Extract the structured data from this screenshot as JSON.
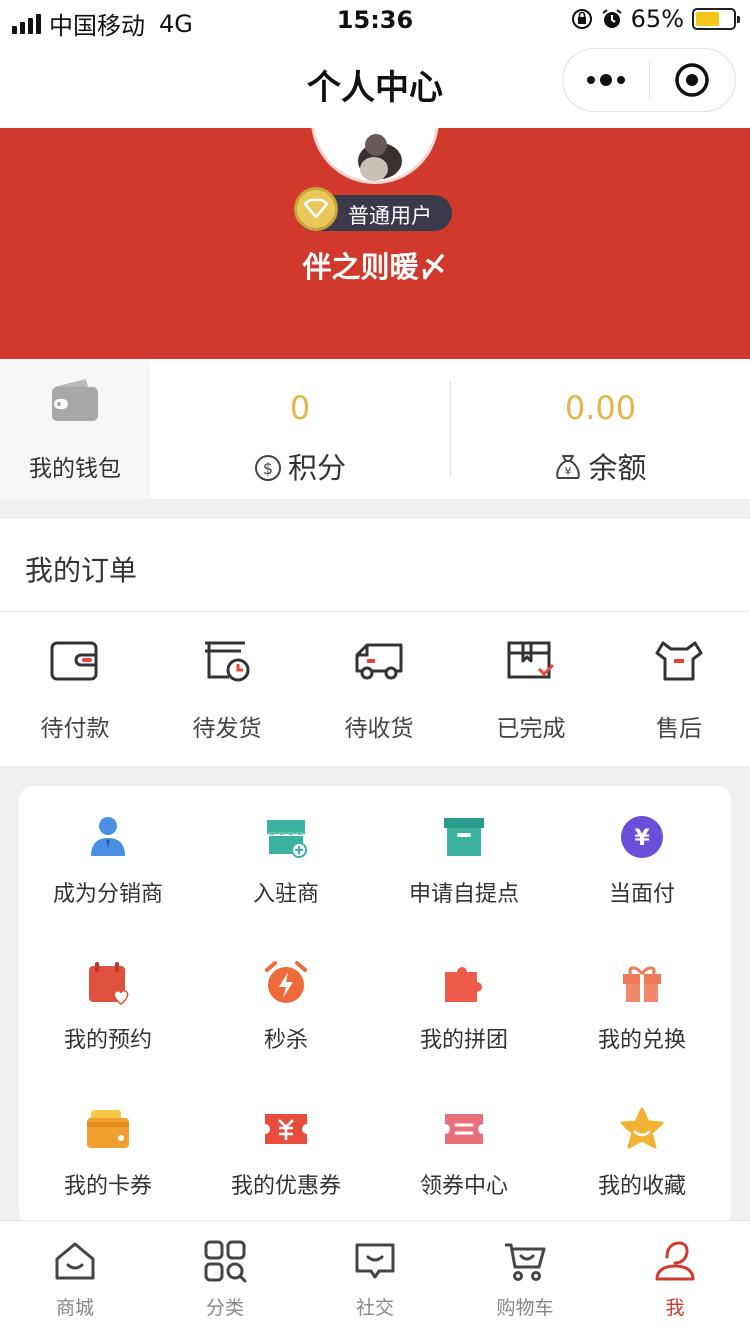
{
  "status_bar": {
    "carrier": "中国移动",
    "network": "4G",
    "time": "15:36",
    "battery": "65%",
    "battery_level": 0.65
  },
  "nav": {
    "title": "个人中心"
  },
  "profile": {
    "badge": "普通用户",
    "username": "伴之则暖〆"
  },
  "wallet": {
    "my_wallet": "我的钱包",
    "points_value": "0",
    "points_label": "积分",
    "balance_value": "0.00",
    "balance_label": "余额"
  },
  "orders": {
    "title": "我的订单",
    "items": [
      {
        "label": "待付款",
        "icon": "wallet-icon"
      },
      {
        "label": "待发货",
        "icon": "clock-box-icon"
      },
      {
        "label": "待收货",
        "icon": "truck-icon"
      },
      {
        "label": "已完成",
        "icon": "box-check-icon"
      },
      {
        "label": "售后",
        "icon": "tshirt-icon"
      }
    ]
  },
  "tools": [
    {
      "label": "成为分销商",
      "icon": "user-icon",
      "color": "#4a90e2"
    },
    {
      "label": "入驻商",
      "icon": "shop-icon",
      "color": "#3bb3a0"
    },
    {
      "label": "申请自提点",
      "icon": "archive-icon",
      "color": "#3bb3a0"
    },
    {
      "label": "当面付",
      "icon": "yen-icon",
      "color": "#6b4fd8"
    },
    {
      "label": "我的预约",
      "icon": "calendar-heart-icon",
      "color": "#e0503f"
    },
    {
      "label": "秒杀",
      "icon": "alarm-bolt-icon",
      "color": "#ef6a3a"
    },
    {
      "label": "我的拼团",
      "icon": "puzzle-icon",
      "color": "#ee5b4a"
    },
    {
      "label": "我的兑换",
      "icon": "gift-icon",
      "color": "#ef7a5a"
    },
    {
      "label": "我的卡券",
      "icon": "card-icon",
      "color": "#f0a030"
    },
    {
      "label": "我的优惠券",
      "icon": "coupon-icon",
      "color": "#e84c3d"
    },
    {
      "label": "领券中心",
      "icon": "ticket-icon",
      "color": "#e9707a"
    },
    {
      "label": "我的收藏",
      "icon": "star-icon",
      "color": "#f2b233"
    }
  ],
  "tabbar": [
    {
      "label": "商城",
      "icon": "home-icon"
    },
    {
      "label": "分类",
      "icon": "grid-icon"
    },
    {
      "label": "社交",
      "icon": "chat-icon"
    },
    {
      "label": "购物车",
      "icon": "cart-icon"
    },
    {
      "label": "我",
      "icon": "person-icon",
      "active": true
    }
  ]
}
